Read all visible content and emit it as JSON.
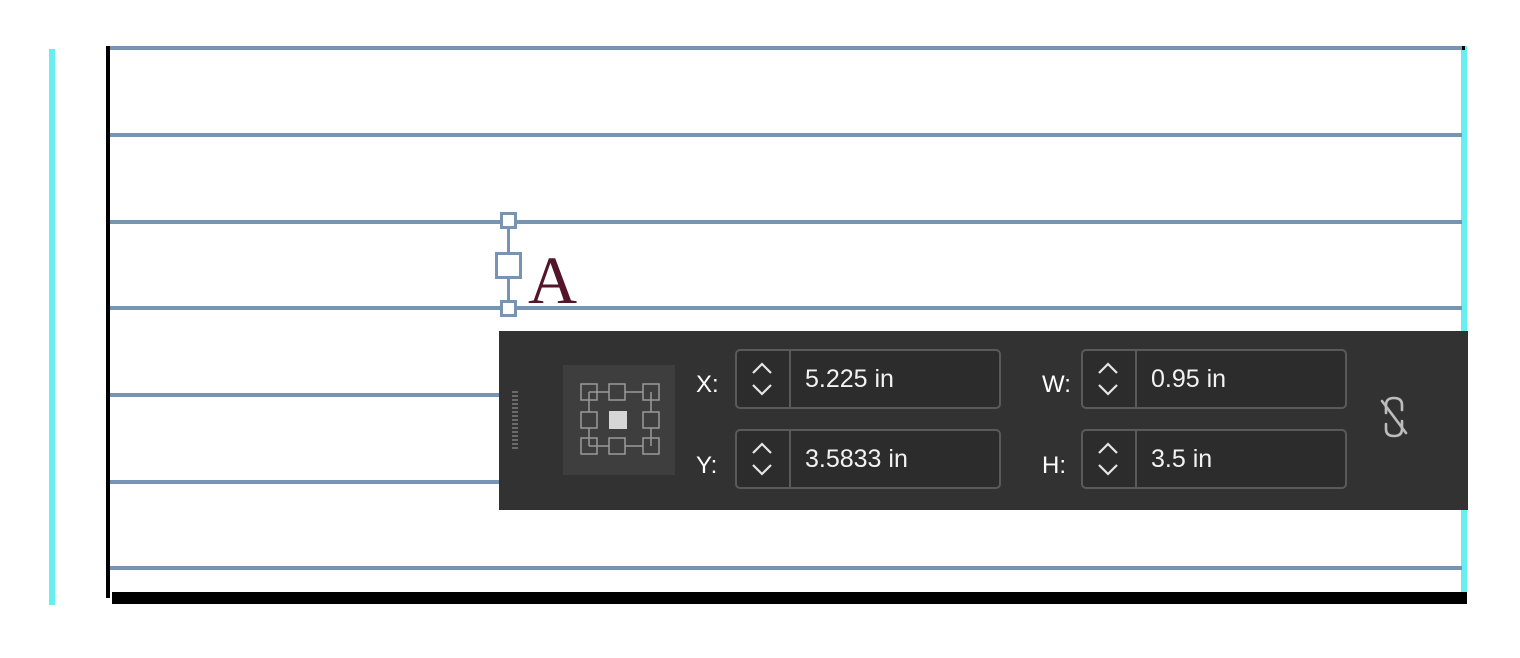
{
  "canvas": {
    "glyph": "A"
  },
  "transform_panel": {
    "x_label": "X:",
    "x_value": "5.225 in",
    "y_label": "Y:",
    "y_value": "3.5833 in",
    "w_label": "W:",
    "w_value": "0.95 in",
    "h_label": "H:",
    "h_value": "3.5 in",
    "reference_point": "center",
    "constrain_icon": "broken-link-icon"
  },
  "colors": {
    "guide": "#66eef0",
    "baseline_grid": "#7894b3",
    "glyph": "#52152a",
    "panel_bg": "#323232"
  }
}
